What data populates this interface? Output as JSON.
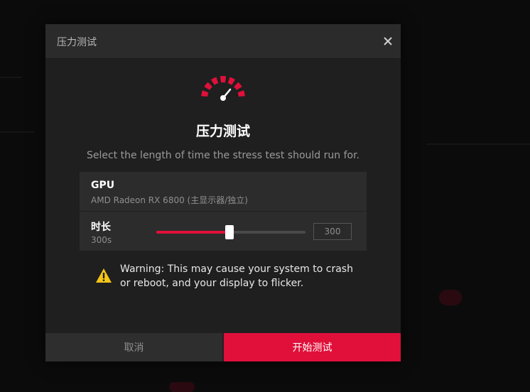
{
  "dialog": {
    "header_title": "压力测试",
    "close_icon": "close-icon",
    "gauge_icon": "speed-gauge-icon",
    "title": "压力测试",
    "description": "Select the length of time the stress test should run for."
  },
  "gpu": {
    "label": "GPU",
    "name": "AMD Radeon RX 6800 (主显示器/独立)"
  },
  "duration": {
    "label": "时长",
    "value_text": "300s",
    "input_value": "300",
    "slider_fraction": 0.49
  },
  "warning": {
    "icon": "warning-icon",
    "text": "Warning: This may cause your system to crash or reboot, and your display to flicker."
  },
  "buttons": {
    "cancel": "取消",
    "start": "开始测试"
  },
  "colors": {
    "accent": "#e0103a",
    "warning": "#f5c518",
    "dialog_bg": "#1f1f1f",
    "card_bg": "#2c2c2c"
  }
}
